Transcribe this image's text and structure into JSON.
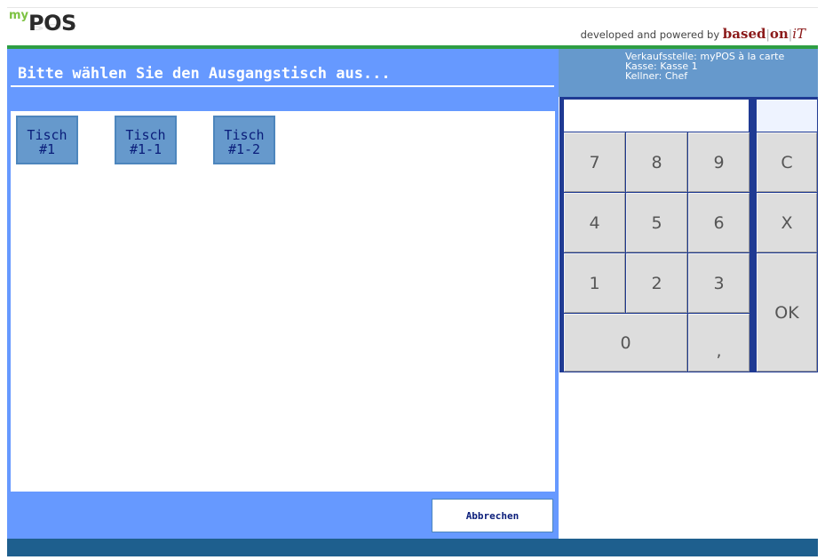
{
  "header": {
    "logo_my": "my",
    "logo_pos": "POS",
    "powered_text": "developed and powered by",
    "brand_based": "based",
    "brand_on": "on",
    "brand_it": "iT",
    "brand_sep": "|"
  },
  "main": {
    "title": "Bitte wählen Sie den Ausgangstisch aus...",
    "tables": [
      {
        "line1": "Tisch",
        "line2": "#1"
      },
      {
        "line1": "Tisch",
        "line2": "#1-1"
      },
      {
        "line1": "Tisch",
        "line2": "#1-2"
      }
    ],
    "cancel_label": "Abbrechen"
  },
  "info": {
    "verkaufsstelle": "Verkaufsstelle: myPOS à la carte",
    "kasse": "Kasse: Kasse 1",
    "kellner": "Kellner: Chef"
  },
  "keypad": {
    "display_value": "",
    "k7": "7",
    "k8": "8",
    "k9": "9",
    "clear": "C",
    "k4": "4",
    "k5": "5",
    "k6": "6",
    "cancel": "X",
    "k1": "1",
    "k2": "2",
    "k3": "3",
    "ok": "OK",
    "k0": "0",
    "comma": ","
  },
  "colors": {
    "accent_blue": "#6699ff",
    "button_blue": "#6699cc",
    "green_rule": "#2e9e43",
    "keypad_frame": "#1f3a93",
    "footer": "#1e5f8e"
  }
}
